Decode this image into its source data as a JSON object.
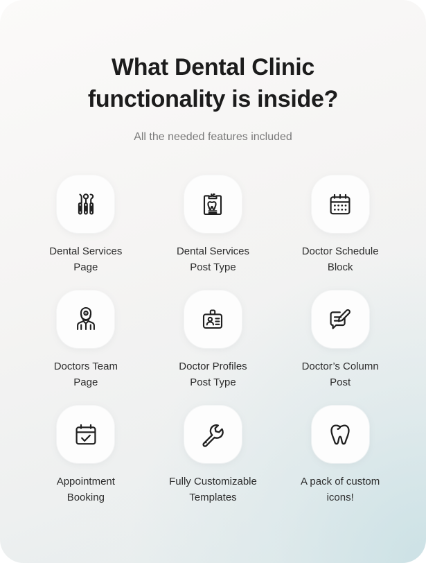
{
  "card": {
    "background_top": "#faf9f8",
    "background_bottom": "#dde8ea",
    "tile_color": "#fdfdfd",
    "icon_color": "#1f1f1f",
    "title_color": "#1c1c1c",
    "subtitle_color": "#7a7a7a",
    "label_color": "#2c2c2c"
  },
  "header": {
    "title": "What Dental Clinic functionality is inside?",
    "subtitle": "All the needed features included"
  },
  "features": [
    {
      "label": "Dental Services\nPage",
      "icon": "dental-tools-icon"
    },
    {
      "label": "Dental Services\nPost Type",
      "icon": "clipboard-tooth-icon"
    },
    {
      "label": "Doctor Schedule\nBlock",
      "icon": "calendar-icon"
    },
    {
      "label": "Doctors Team\nPage",
      "icon": "doctor-icon"
    },
    {
      "label": "Doctor Profiles\nPost Type",
      "icon": "id-badge-icon"
    },
    {
      "label": "Doctor’s Column\nPost",
      "icon": "comment-edit-icon"
    },
    {
      "label": "Appointment\nBooking",
      "icon": "calendar-check-icon"
    },
    {
      "label": "Fully Customizable\nTemplates",
      "icon": "wrench-icon"
    },
    {
      "label": "A pack of custom\nicons!",
      "icon": "tooth-icon"
    }
  ]
}
